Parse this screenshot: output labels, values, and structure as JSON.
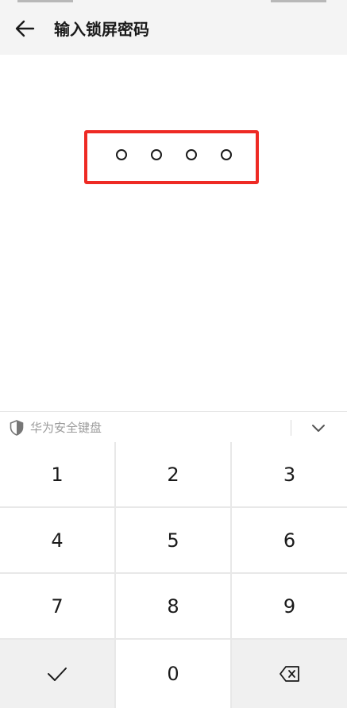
{
  "header": {
    "title": "输入锁屏密码",
    "back_icon": "back-arrow-icon"
  },
  "pin": {
    "length": 4,
    "entered": 0,
    "highlight_color": "#ee2a24"
  },
  "keyboard": {
    "label": "华为安全键盘",
    "shield_icon": "shield-icon",
    "collapse_icon": "chevron-down-icon",
    "keys": {
      "k1": "1",
      "k2": "2",
      "k3": "3",
      "k4": "4",
      "k5": "5",
      "k6": "6",
      "k7": "7",
      "k8": "8",
      "k9": "9",
      "k0": "0"
    },
    "confirm_icon": "checkmark-icon",
    "delete_icon": "backspace-icon"
  }
}
